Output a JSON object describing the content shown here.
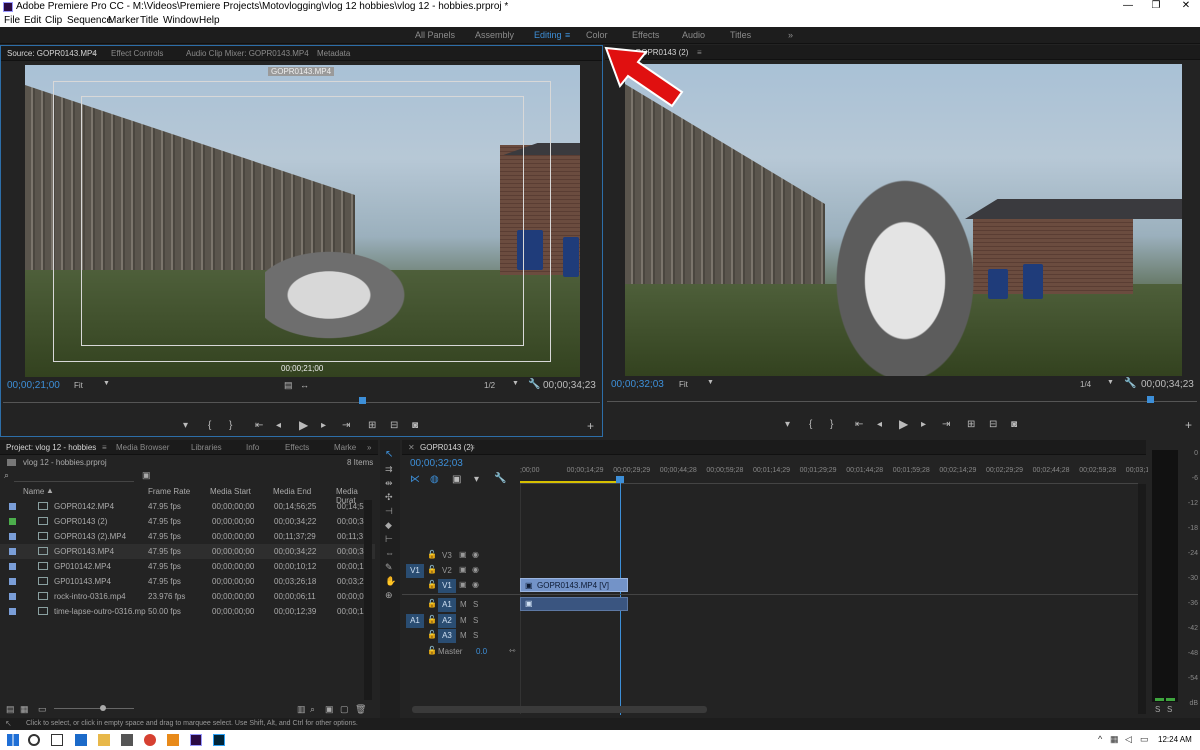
{
  "window": {
    "title": "Adobe Premiere Pro CC - M:\\Videos\\Premiere Projects\\Motovlogging\\vlog 12 hobbies\\vlog 12 - hobbies.prproj *",
    "min": "—",
    "max": "❐",
    "close": "✕"
  },
  "menu": [
    "File",
    "Edit",
    "Clip",
    "Sequence",
    "Marker",
    "Title",
    "Window",
    "Help"
  ],
  "workspaces": [
    "All Panels",
    "Assembly",
    "Editing",
    "Color",
    "Effects",
    "Audio",
    "Titles"
  ],
  "workspace_more": "»",
  "source": {
    "tabs": [
      "Source: GOPR0143.MP4",
      "Effect Controls",
      "Audio Clip Mixer: GOPR0143.MP4",
      "Metadata"
    ],
    "overlay_top": "GOPR0143.MP4",
    "overlay_tc": "00;00;21;00",
    "timecode": "00;00;21;00",
    "fit": "Fit",
    "resolution": "1/2",
    "duration": "00;00;34;23"
  },
  "program": {
    "tab": "GOPR0143 (2)",
    "timecode": "00;00;32;03",
    "fit": "Fit",
    "resolution": "1/4",
    "duration": "00;00;34;23"
  },
  "project": {
    "tabs": [
      "Project: vlog 12 - hobbies",
      "Media Browser",
      "Libraries",
      "Info",
      "Effects",
      "Marke"
    ],
    "file": "vlog 12 - hobbies.prproj",
    "count": "8 Items",
    "columns": [
      "Name",
      "Frame Rate",
      "Media Start",
      "Media End",
      "Media Durat"
    ],
    "rows": [
      {
        "name": "GOPR0142.MP4",
        "rate": "47.95 fps",
        "start": "00;00;00;00",
        "end": "00;14;56;25",
        "dur": "00;14;5",
        "color": "#7a9ed8"
      },
      {
        "name": "GOPR0143 (2)",
        "rate": "47.95 fps",
        "start": "00;00;00;00",
        "end": "00;00;34;22",
        "dur": "00;00;3",
        "color": "#4cae4c"
      },
      {
        "name": "GOPR0143 (2).MP4",
        "rate": "47.95 fps",
        "start": "00;00;00;00",
        "end": "00;11;37;29",
        "dur": "00;11;3",
        "color": "#7a9ed8"
      },
      {
        "name": "GOPR0143.MP4",
        "rate": "47.95 fps",
        "start": "00;00;00;00",
        "end": "00;00;34;22",
        "dur": "00;00;3",
        "color": "#7a9ed8"
      },
      {
        "name": "GP010142.MP4",
        "rate": "47.95 fps",
        "start": "00;00;00;00",
        "end": "00;00;10;12",
        "dur": "00;00;1",
        "color": "#7a9ed8"
      },
      {
        "name": "GP010143.MP4",
        "rate": "47.95 fps",
        "start": "00;00;00;00",
        "end": "00;03;26;18",
        "dur": "00;03;2",
        "color": "#7a9ed8"
      },
      {
        "name": "rock-intro-0316.mp4",
        "rate": "23.976 fps",
        "start": "00;00;00;00",
        "end": "00;00;06;11",
        "dur": "00;00;0",
        "color": "#7a9ed8"
      },
      {
        "name": "time-lapse-outro-0316.mp",
        "rate": "50.00 fps",
        "start": "00;00;00;00",
        "end": "00;00;12;39",
        "dur": "00;00;1",
        "color": "#7a9ed8"
      }
    ]
  },
  "timeline": {
    "tab": "GOPR0143 (2)",
    "timecode": "00;00;32;03",
    "ruler": [
      ";00;00",
      "00;00;14;29",
      "00;00;29;29",
      "00;00;44;28",
      "00;00;59;28",
      "00;01;14;29",
      "00;01;29;29",
      "00;01;44;28",
      "00;01;59;28",
      "00;02;14;29",
      "00;02;29;29",
      "00;02;44;28",
      "00;02;59;28",
      "00;03;1"
    ],
    "video_tracks": [
      "V3",
      "V2",
      "V1"
    ],
    "audio_tracks": [
      "A1",
      "A2",
      "A3"
    ],
    "src_v": "V1",
    "src_a": "A1",
    "master": "Master",
    "master_val": "0.0",
    "clip_label": "GOPR0143.MP4 [V]"
  },
  "meter": {
    "ticks": [
      "0",
      "-6",
      "-12",
      "-18",
      "-24",
      "-30",
      "-36",
      "-42",
      "-48",
      "-54",
      "dB"
    ],
    "solo_left": "S",
    "solo_right": "S"
  },
  "status": "Click to select, or click in empty space and drag to marquee select. Use Shift, Alt, and Ctrl for other options.",
  "clock": "12:24 AM"
}
